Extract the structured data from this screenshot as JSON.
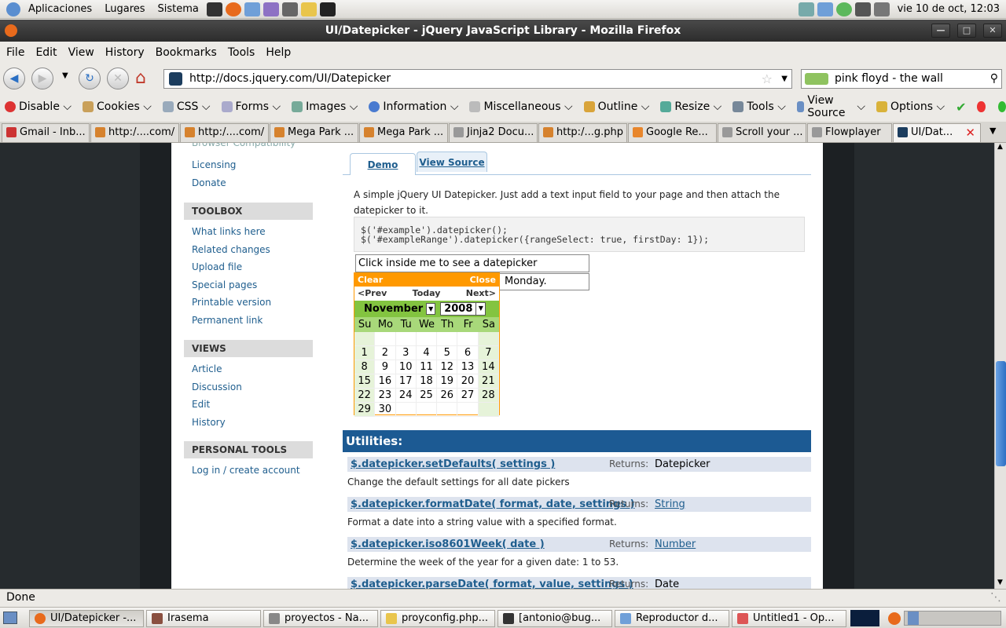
{
  "gnome_top": {
    "menus": [
      "Aplicaciones",
      "Lugares",
      "Sistema"
    ],
    "clock": "vie 10 de oct, 12:03"
  },
  "window": {
    "title": "UI/Datepicker - jQuery JavaScript Library - Mozilla Firefox"
  },
  "menubar": [
    "File",
    "Edit",
    "View",
    "History",
    "Bookmarks",
    "Tools",
    "Help"
  ],
  "nav": {
    "url": "http://docs.jquery.com/UI/Datepicker",
    "search": "pink floyd - the wall"
  },
  "devbar": [
    "Disable",
    "Cookies",
    "CSS",
    "Forms",
    "Images",
    "Information",
    "Miscellaneous",
    "Outline",
    "Resize",
    "Tools",
    "View Source",
    "Options"
  ],
  "tabs": [
    "Gmail - Inb...",
    "http:/....com/",
    "http:/....com/",
    "Mega Park ...",
    "Mega Park ...",
    "Jinja2 Docu...",
    "http:/...g.php",
    "Google Re...",
    "Scroll your ...",
    "Flowplayer",
    "UI/Dat..."
  ],
  "sidebar": {
    "partial_link": "Browser Compatibility",
    "top_links": [
      "Licensing",
      "Donate"
    ],
    "toolbox_title": "TOOLBOX",
    "toolbox": [
      "What links here",
      "Related changes",
      "Upload file",
      "Special pages",
      "Printable version",
      "Permanent link"
    ],
    "views_title": "VIEWS",
    "views": [
      "Article",
      "Discussion",
      "Edit",
      "History"
    ],
    "personal_title": "PERSONAL TOOLS",
    "personal": [
      "Log in / create account"
    ]
  },
  "content": {
    "tab_demo": "Demo",
    "tab_source": "View Source",
    "intro": "A simple jQuery UI Datepicker. Just add a text input field to your page and then attach the datepicker to it.",
    "code_line1": "$('#example').datepicker();",
    "code_line2": "$('#exampleRange').datepicker({rangeSelect: true, firstDay: 1});",
    "input1": "Click inside me to see a datepicker",
    "input2": "Monday."
  },
  "datepicker": {
    "clear": "Clear",
    "close": "Close",
    "prev": "<Prev",
    "today": "Today",
    "next": "Next>",
    "month": "November",
    "year": "2008",
    "dow": [
      "Su",
      "Mo",
      "Tu",
      "We",
      "Th",
      "Fr",
      "Sa"
    ],
    "weeks": [
      [
        "",
        "",
        "",
        "",
        "",
        "",
        ""
      ],
      [
        "1",
        "2",
        "3",
        "4",
        "5",
        "6",
        "7"
      ],
      [
        "8",
        "9",
        "10",
        "11",
        "12",
        "13",
        "14"
      ],
      [
        "15",
        "16",
        "17",
        "18",
        "19",
        "20",
        "21"
      ],
      [
        "22",
        "23",
        "24",
        "25",
        "26",
        "27",
        "28"
      ],
      [
        "29",
        "30",
        "",
        "",
        "",
        "",
        ""
      ]
    ]
  },
  "utilities": {
    "title": "Utilities:",
    "returns_label": "Returns:",
    "items": [
      {
        "name": "$.datepicker.setDefaults( settings )",
        "returns": "Datepicker",
        "desc": "Change the default settings for all date pickers"
      },
      {
        "name": "$.datepicker.formatDate( format, date, settings )",
        "returns": "String",
        "desc": "Format a date into a string value with a specified format."
      },
      {
        "name": "$.datepicker.iso8601Week( date )",
        "returns": "Number",
        "desc": "Determine the week of the year for a given date: 1 to 53."
      },
      {
        "name": "$.datepicker.parseDate( format, value, settings )",
        "returns": "Date",
        "desc": ""
      }
    ]
  },
  "status": "Done",
  "taskbar": [
    "UI/Datepicker -...",
    "Irasema",
    "proyectos - Na...",
    "proyconfig.php...",
    "[antonio@bug...",
    "Reproductor d...",
    "Untitled1 - Op..."
  ]
}
